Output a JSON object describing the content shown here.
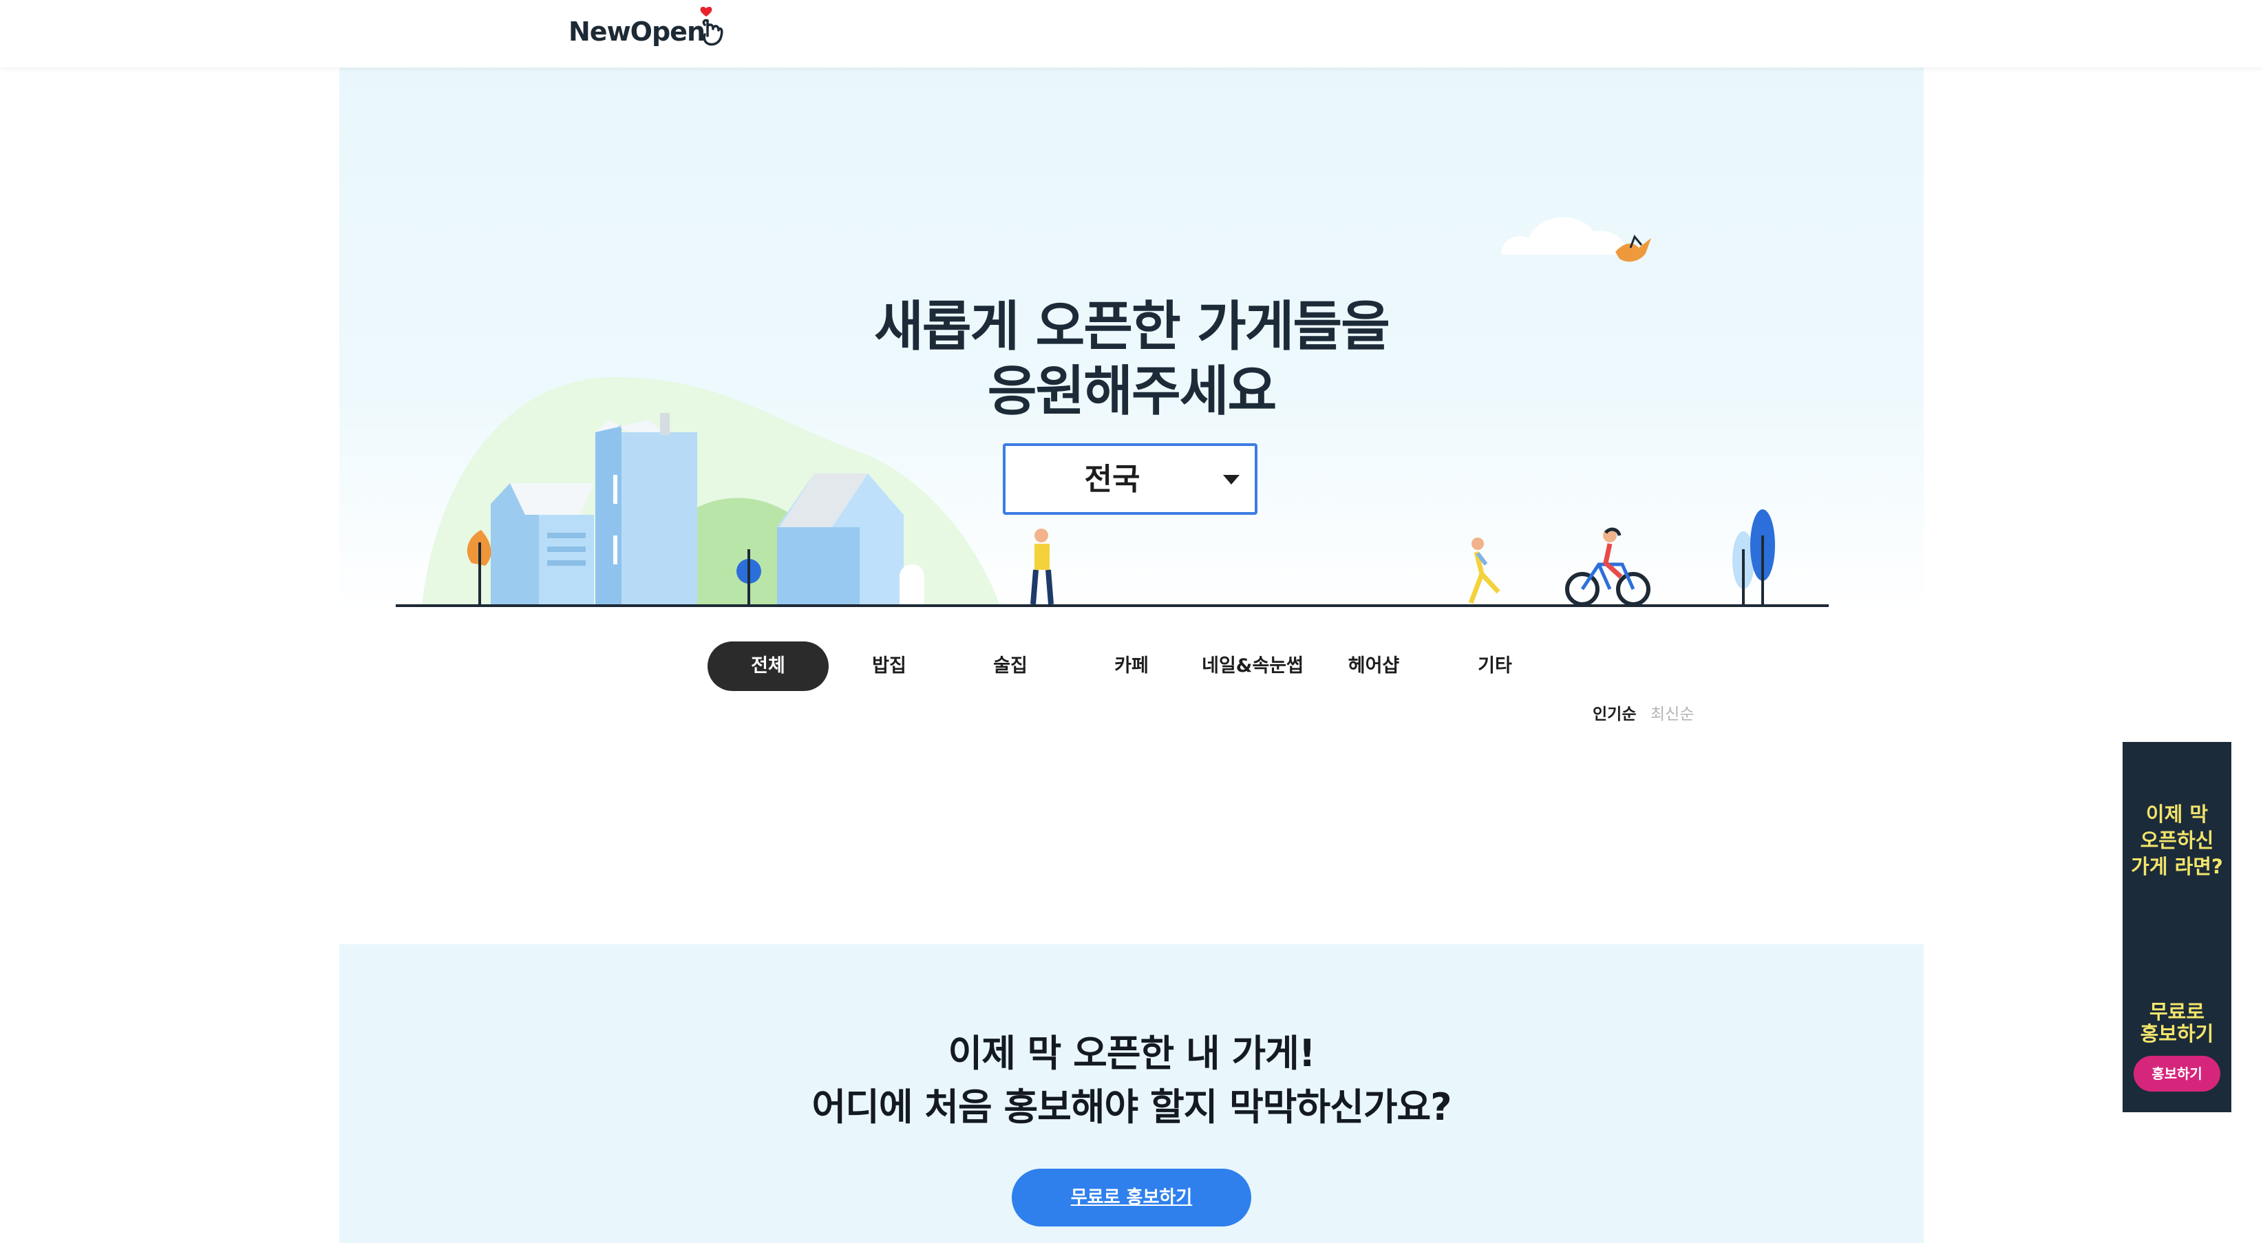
{
  "header": {
    "logo_text": "NewOpen",
    "logo_icon": "finger-heart-icon"
  },
  "hero": {
    "title_line1": "새롭게 오픈한 가게들을",
    "title_line2": "응원해주세요",
    "region_select": {
      "value": "전국",
      "icon": "chevron-down-icon"
    }
  },
  "categories": {
    "items": [
      "전체",
      "밥집",
      "술집",
      "카페",
      "네일&속눈썹",
      "헤어샵",
      "기타"
    ],
    "active": "전체"
  },
  "sort": {
    "popular": "인기순",
    "latest": "최신순",
    "active": "인기순"
  },
  "promo": {
    "title_line1": "이제 막 오픈한 내 가게!",
    "title_line2": "어디에 처음 홍보해야 할지 막막하신가요?",
    "button": "무료로 홍보하기"
  },
  "side_banner": {
    "text1": "이제 막\n오픈하신\n가게 라면?",
    "text2": "무료로\n홍보하기",
    "button": "홍보하기"
  },
  "colors": {
    "hero_bg": "#e9f7fc",
    "accent_blue": "#2f80ed",
    "select_border": "#3d7de3",
    "active_tab": "#2b2b2b",
    "banner_bg": "#1c2b3a",
    "banner_text": "#f3e56b",
    "banner_button": "#d6267c"
  }
}
